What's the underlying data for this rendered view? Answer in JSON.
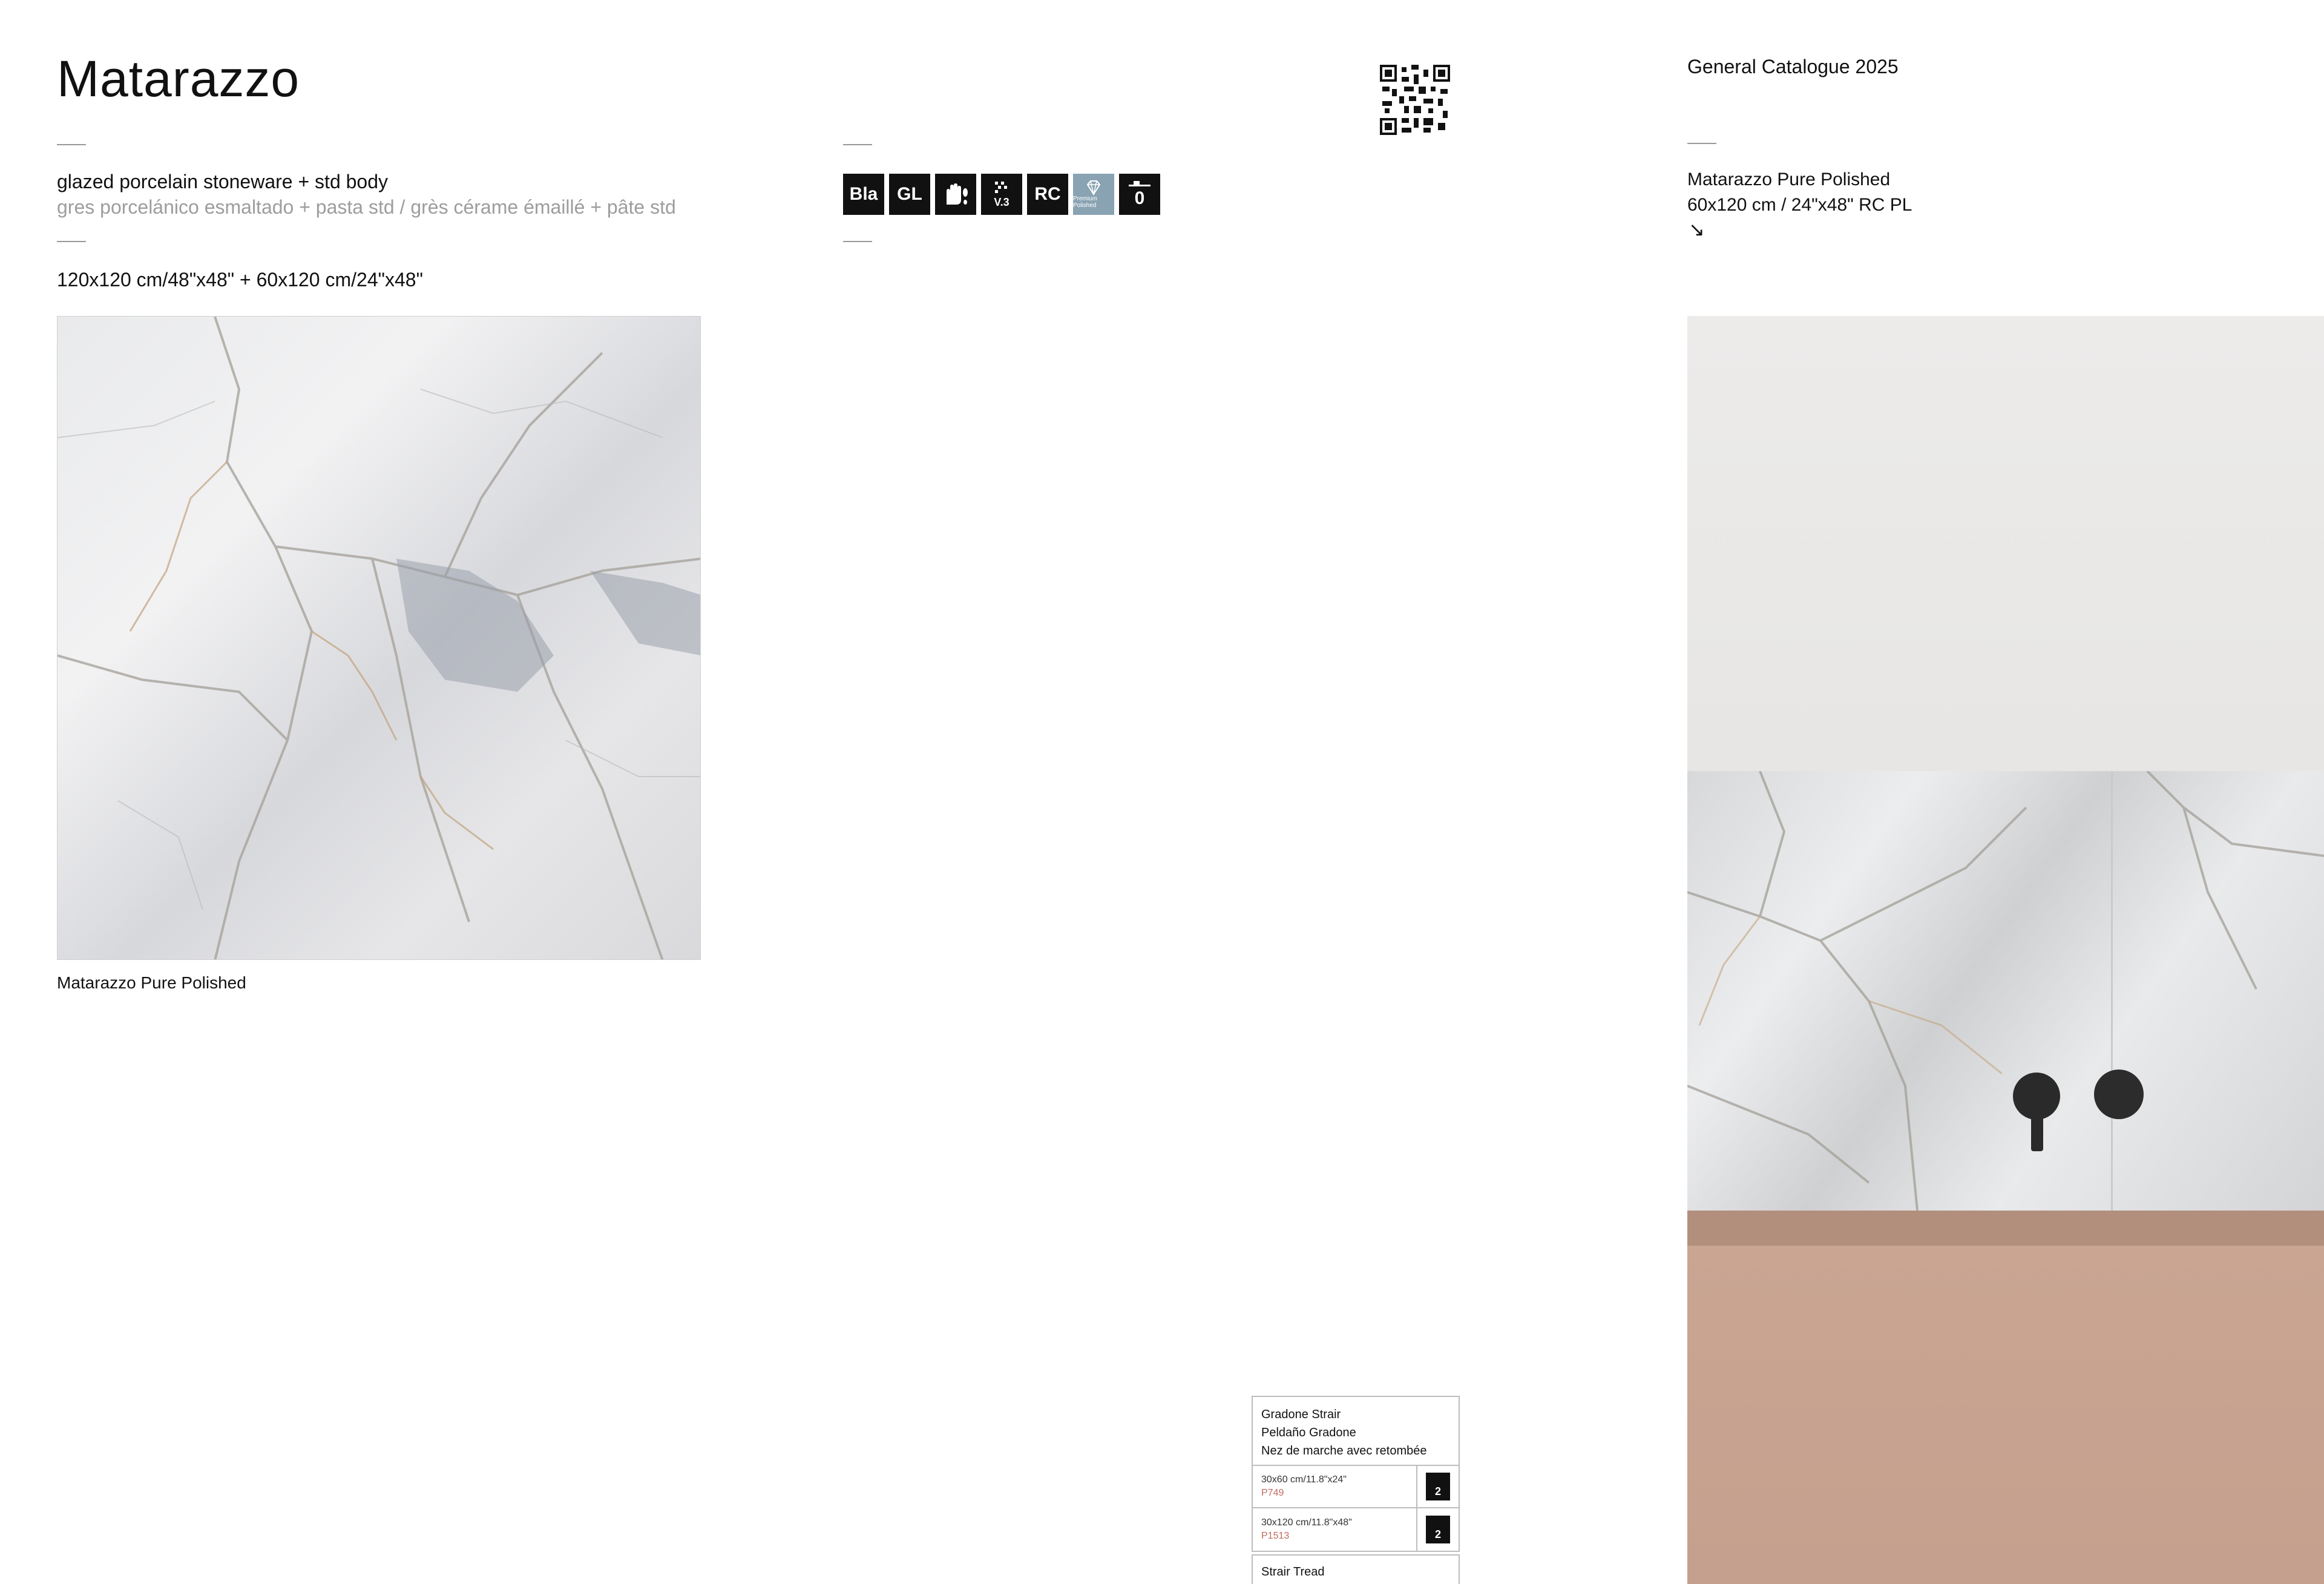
{
  "header": {
    "title": "Matarazzo",
    "catalogue": "General Catalogue 2025"
  },
  "description": {
    "en": "glazed porcelain stoneware + std body",
    "es_fr": "gres porcelánico esmaltado + pasta std / grès cérame émaillé + pâte std",
    "sizes": "120x120 cm/48\"x48\" + 60x120 cm/24\"x48\""
  },
  "icons": [
    {
      "name": "bla-icon",
      "label": "Bla"
    },
    {
      "name": "gl-icon",
      "label": "GL"
    },
    {
      "name": "touch-icon",
      "label": ""
    },
    {
      "name": "variation-icon",
      "label": "V.3"
    },
    {
      "name": "rc-icon",
      "label": "RC"
    },
    {
      "name": "premium-polished-icon",
      "label": "Premium Polished"
    },
    {
      "name": "thickness-icon",
      "label": "0"
    }
  ],
  "product_ref": {
    "line1": "Matarazzo Pure Polished",
    "line2": "60x120 cm / 24\"x48\" RC PL",
    "arrow": "↘"
  },
  "tile": {
    "caption": "Matarazzo Pure Polished"
  },
  "trim_table": {
    "title_lines": [
      "Gradone Strair",
      "Peldaño Gradone",
      "Nez de marche avec retombée"
    ],
    "rows": [
      {
        "size": "30x60 cm/11.8\"x24\"",
        "code": "P749",
        "pack": "2"
      },
      {
        "size": "30x120 cm/11.8\"x48\"",
        "code": "P1513",
        "pack": "2"
      }
    ]
  },
  "trim_table_2": {
    "title": "Strair Tread"
  }
}
